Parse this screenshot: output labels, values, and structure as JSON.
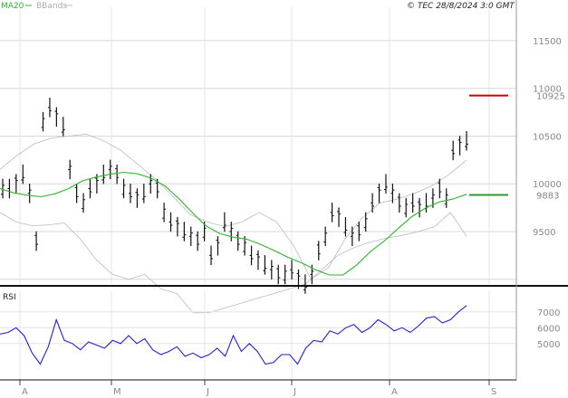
{
  "chart_data": [
    {
      "type": "ohlc",
      "legend": [
        "MA20",
        "BBands"
      ],
      "credit": "© TEC 28/8/2024 3:0 GMT",
      "x_tick_labels": [
        "A",
        "M",
        "J",
        "J",
        "A",
        "S"
      ],
      "y_ticks": [
        9500,
        10000,
        10500,
        11000,
        11500
      ],
      "ylim": [
        8950,
        11850
      ],
      "markers": [
        {
          "label": "10925",
          "value": 10925,
          "color": "#cc0000"
        },
        {
          "label": "9883",
          "value": 9883,
          "color": "#2a9a2a"
        }
      ],
      "grid": true,
      "series": [
        {
          "name": "MA20",
          "color": "#2db52d",
          "values": [
            9950,
            9905,
            9880,
            9865,
            9895,
            9950,
            10030,
            10070,
            10100,
            10120,
            10105,
            10060,
            9980,
            9850,
            9700,
            9560,
            9480,
            9440,
            9420,
            9365,
            9300,
            9230,
            9170,
            9100,
            9045,
            9045,
            9150,
            9290,
            9400,
            9530,
            9655,
            9745,
            9810,
            9840,
            9890
          ]
        },
        {
          "name": "BBands",
          "color": "#bbbbbb",
          "values": [
            10150,
            10300,
            10420,
            10480,
            10500,
            10520,
            10450,
            10350,
            10200,
            10050,
            9870,
            9680,
            9600,
            9550,
            9600,
            9700,
            9600,
            9350,
            9000,
            9120,
            9430,
            9650,
            9800,
            9840,
            9900,
            9980,
            10100,
            10250
          ]
        },
        {
          "name": "BBands",
          "color": "#bbbbbb",
          "values": [
            9700,
            9600,
            9560,
            9570,
            9590,
            9420,
            9200,
            9050,
            9000,
            9050,
            8900,
            8850,
            8650,
            8650,
            8700,
            8750,
            8800,
            8850,
            8900,
            8950,
            9100,
            9250,
            9330,
            9390,
            9430,
            9460,
            9500,
            9550,
            9700,
            9450
          ]
        }
      ],
      "ohlc_values": [
        9950,
        9950,
        10000,
        10100,
        9900,
        9400,
        10650,
        10800,
        10700,
        10600,
        10150,
        9900,
        9800,
        9950,
        10000,
        10100,
        10150,
        10100,
        9950,
        9900,
        9850,
        9900,
        10000,
        9950,
        9700,
        9600,
        9550,
        9500,
        9450,
        9400,
        9500,
        9250,
        9350,
        9600,
        9500,
        9400,
        9350,
        9250,
        9200,
        9150,
        9100,
        9050,
        9050,
        9100,
        9000,
        8950,
        9050,
        9300,
        9450,
        9700,
        9650,
        9550,
        9450,
        9500,
        9600,
        9800,
        9900,
        10000,
        9900,
        9800,
        9750,
        9800,
        9750,
        9800,
        9850,
        9950,
        9850,
        10350,
        10400,
        10450
      ]
    },
    {
      "type": "line",
      "title": "RSI",
      "x_tick_labels": [
        "A",
        "M",
        "J",
        "J",
        "A",
        "S"
      ],
      "y_ticks": [
        50,
        60,
        70
      ],
      "y_tick_labels": [
        "5000",
        "6000",
        "7000"
      ],
      "ylim": [
        27,
        83
      ],
      "series": [
        {
          "name": "RSI",
          "color": "#2222cc",
          "values": [
            56,
            57,
            60,
            55,
            44,
            37,
            48,
            65,
            52,
            50,
            46,
            51,
            49,
            47,
            52,
            50,
            55,
            50,
            53,
            46,
            43,
            45,
            48,
            42,
            44,
            41,
            43,
            47,
            42,
            55,
            45,
            50,
            45,
            37,
            38,
            43,
            43,
            37,
            47,
            52,
            51,
            58,
            56,
            60,
            62,
            57,
            60,
            65,
            62,
            58,
            60,
            57,
            61,
            66,
            67,
            63,
            65,
            70,
            74
          ]
        }
      ]
    }
  ]
}
